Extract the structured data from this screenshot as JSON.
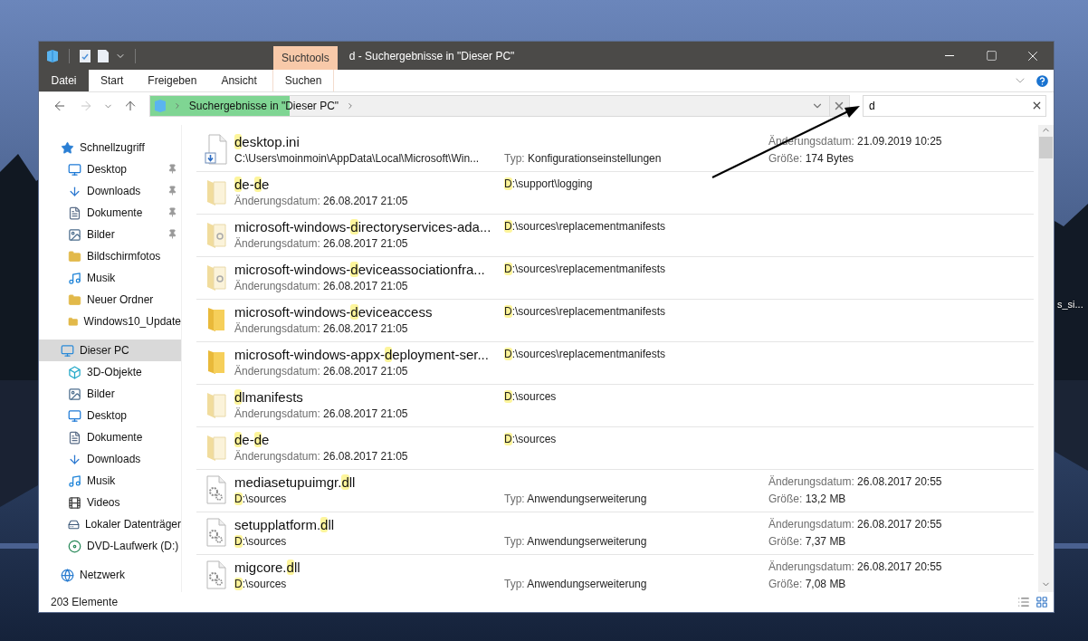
{
  "desktop": {
    "icon_label": "s_si..."
  },
  "window": {
    "title": "d - Suchergebnisse in \"Dieser PC\"",
    "contextual_tab": "Suchtools",
    "ribbon_tabs": [
      {
        "label": "Datei",
        "kind": "file",
        "selected": false
      },
      {
        "label": "Start",
        "kind": "tab",
        "selected": false
      },
      {
        "label": "Freigeben",
        "kind": "tab",
        "selected": false
      },
      {
        "label": "Ansicht",
        "kind": "tab",
        "selected": false
      },
      {
        "label": "Suchen",
        "kind": "context",
        "selected": false
      }
    ],
    "nav": [
      {
        "kind": "back",
        "disabled": false
      },
      {
        "kind": "forward",
        "disabled": true
      },
      {
        "kind": "recent",
        "disabled": false
      },
      {
        "kind": "up",
        "disabled": false
      }
    ],
    "address": {
      "level": 0.2,
      "crumb": "Suchergebnisse in \"Dieser PC\""
    },
    "search": {
      "value": "d"
    },
    "sidebar": [
      {
        "label": "Schnellzugriff",
        "kind": "star",
        "selected": false,
        "children": [
          {
            "label": "Desktop",
            "kind": "desktop",
            "pinned": true,
            "selected": false
          },
          {
            "label": "Downloads",
            "kind": "download",
            "pinned": true,
            "selected": false
          },
          {
            "label": "Dokumente",
            "kind": "document",
            "pinned": true,
            "selected": false
          },
          {
            "label": "Bilder",
            "kind": "pictures",
            "pinned": true,
            "selected": false
          },
          {
            "label": "Bildschirmfotos",
            "kind": "folder",
            "pinned": false,
            "selected": false
          },
          {
            "label": "Musik",
            "kind": "music",
            "pinned": false,
            "selected": false
          },
          {
            "label": "Neuer Ordner",
            "kind": "folder",
            "pinned": false,
            "selected": false
          },
          {
            "label": "Windows10_Update",
            "kind": "folder",
            "pinned": false,
            "selected": false
          }
        ]
      },
      {
        "label": "Dieser PC",
        "kind": "pc",
        "selected": true,
        "children": [
          {
            "label": "3D-Objekte",
            "kind": "cube",
            "pinned": false,
            "selected": false
          },
          {
            "label": "Bilder",
            "kind": "pictures",
            "pinned": false,
            "selected": false
          },
          {
            "label": "Desktop",
            "kind": "desktop",
            "pinned": false,
            "selected": false
          },
          {
            "label": "Dokumente",
            "kind": "document",
            "pinned": false,
            "selected": false
          },
          {
            "label": "Downloads",
            "kind": "download",
            "pinned": false,
            "selected": false
          },
          {
            "label": "Musik",
            "kind": "music",
            "pinned": false,
            "selected": false
          },
          {
            "label": "Videos",
            "kind": "video",
            "pinned": false,
            "selected": false
          },
          {
            "label": "Lokaler Datenträger",
            "kind": "drive",
            "pinned": false,
            "selected": false
          },
          {
            "label": "DVD-Laufwerk (D:)",
            "kind": "dvd",
            "pinned": false,
            "selected": false
          }
        ]
      },
      {
        "label": "Netzwerk",
        "kind": "network",
        "selected": false
      }
    ],
    "results": [
      {
        "kind": "ini",
        "name": [
          {
            "text": "d",
            "match": true
          },
          {
            "text": "esktop.ini",
            "match": false
          }
        ],
        "location": [
          {
            "text": "C:\\Users\\moinmoin\\AppData\\Local\\Microsoft\\Win...",
            "match": false
          }
        ],
        "type_label": "Typ:",
        "type": "Konfigurationseinstellungen",
        "date_label": "Änderungsdatum:",
        "date": "21.09.2019 10:25",
        "size_label": "Größe:",
        "size": "174 Bytes"
      },
      {
        "kind": "folder-pale",
        "name": [
          {
            "text": "d",
            "match": true
          },
          {
            "text": "e-",
            "match": false
          },
          {
            "text": "d",
            "match": true
          },
          {
            "text": "e",
            "match": false
          }
        ],
        "date_label": "Änderungsdatum:",
        "date": "26.08.2017 21:05",
        "location": [
          {
            "text": "D",
            "match": true
          },
          {
            "text": ":\\support\\logging",
            "match": false
          }
        ]
      },
      {
        "kind": "folder-pale-gear",
        "name": [
          {
            "text": "microsoft-windows-",
            "match": false
          },
          {
            "text": "d",
            "match": true
          },
          {
            "text": "irectoryservices-ada...",
            "match": false
          }
        ],
        "date_label": "Änderungsdatum:",
        "date": "26.08.2017 21:05",
        "location": [
          {
            "text": "D",
            "match": true
          },
          {
            "text": ":\\sources\\replacementmanifests",
            "match": false
          }
        ]
      },
      {
        "kind": "folder-pale-gear",
        "name": [
          {
            "text": "microsoft-windows-",
            "match": false
          },
          {
            "text": "d",
            "match": true
          },
          {
            "text": "eviceassociationfra...",
            "match": false
          }
        ],
        "date_label": "Änderungsdatum:",
        "date": "26.08.2017 21:05",
        "location": [
          {
            "text": "D",
            "match": true
          },
          {
            "text": ":\\sources\\replacementmanifests",
            "match": false
          }
        ]
      },
      {
        "kind": "folder",
        "name": [
          {
            "text": "microsoft-windows-",
            "match": false
          },
          {
            "text": "d",
            "match": true
          },
          {
            "text": "eviceaccess",
            "match": false
          }
        ],
        "date_label": "Änderungsdatum:",
        "date": "26.08.2017 21:05",
        "location": [
          {
            "text": "D",
            "match": true
          },
          {
            "text": ":\\sources\\replacementmanifests",
            "match": false
          }
        ]
      },
      {
        "kind": "folder",
        "name": [
          {
            "text": "microsoft-windows-appx-",
            "match": false
          },
          {
            "text": "d",
            "match": true
          },
          {
            "text": "eployment-ser...",
            "match": false
          }
        ],
        "date_label": "Änderungsdatum:",
        "date": "26.08.2017 21:05",
        "location": [
          {
            "text": "D",
            "match": true
          },
          {
            "text": ":\\sources\\replacementmanifests",
            "match": false
          }
        ]
      },
      {
        "kind": "folder-pale",
        "name": [
          {
            "text": "d",
            "match": true
          },
          {
            "text": "lmanifests",
            "match": false
          }
        ],
        "date_label": "Änderungsdatum:",
        "date": "26.08.2017 21:05",
        "location": [
          {
            "text": "D",
            "match": true
          },
          {
            "text": ":\\sources",
            "match": false
          }
        ]
      },
      {
        "kind": "folder-pale",
        "name": [
          {
            "text": "d",
            "match": true
          },
          {
            "text": "e-",
            "match": false
          },
          {
            "text": "d",
            "match": true
          },
          {
            "text": "e",
            "match": false
          }
        ],
        "date_label": "Änderungsdatum:",
        "date": "26.08.2017 21:05",
        "location": [
          {
            "text": "D",
            "match": true
          },
          {
            "text": ":\\sources",
            "match": false
          }
        ]
      },
      {
        "kind": "dll",
        "name": [
          {
            "text": "mediasetupuimgr.",
            "match": false
          },
          {
            "text": "d",
            "match": true
          },
          {
            "text": "ll",
            "match": false
          }
        ],
        "location": [
          {
            "text": "D",
            "match": true
          },
          {
            "text": ":\\sources",
            "match": false
          }
        ],
        "type_label": "Typ:",
        "type": "Anwendungserweiterung",
        "date_label": "Änderungsdatum:",
        "date": "26.08.2017 20:55",
        "size_label": "Größe:",
        "size": "13,2 MB"
      },
      {
        "kind": "dll",
        "name": [
          {
            "text": "setupplatform.",
            "match": false
          },
          {
            "text": "d",
            "match": true
          },
          {
            "text": "ll",
            "match": false
          }
        ],
        "location": [
          {
            "text": "D",
            "match": true
          },
          {
            "text": ":\\sources",
            "match": false
          }
        ],
        "type_label": "Typ:",
        "type": "Anwendungserweiterung",
        "date_label": "Änderungsdatum:",
        "date": "26.08.2017 20:55",
        "size_label": "Größe:",
        "size": "7,37 MB"
      },
      {
        "kind": "dll",
        "name": [
          {
            "text": "migcore.",
            "match": false
          },
          {
            "text": "d",
            "match": true
          },
          {
            "text": "ll",
            "match": false
          }
        ],
        "location": [
          {
            "text": "D",
            "match": true
          },
          {
            "text": ":\\sources",
            "match": false
          }
        ],
        "type_label": "Typ:",
        "type": "Anwendungserweiterung",
        "date_label": "Änderungsdatum:",
        "date": "26.08.2017 20:55",
        "size_label": "Größe:",
        "size": "7,08 MB"
      }
    ],
    "status_bar": {
      "count": "203 Elemente"
    }
  }
}
